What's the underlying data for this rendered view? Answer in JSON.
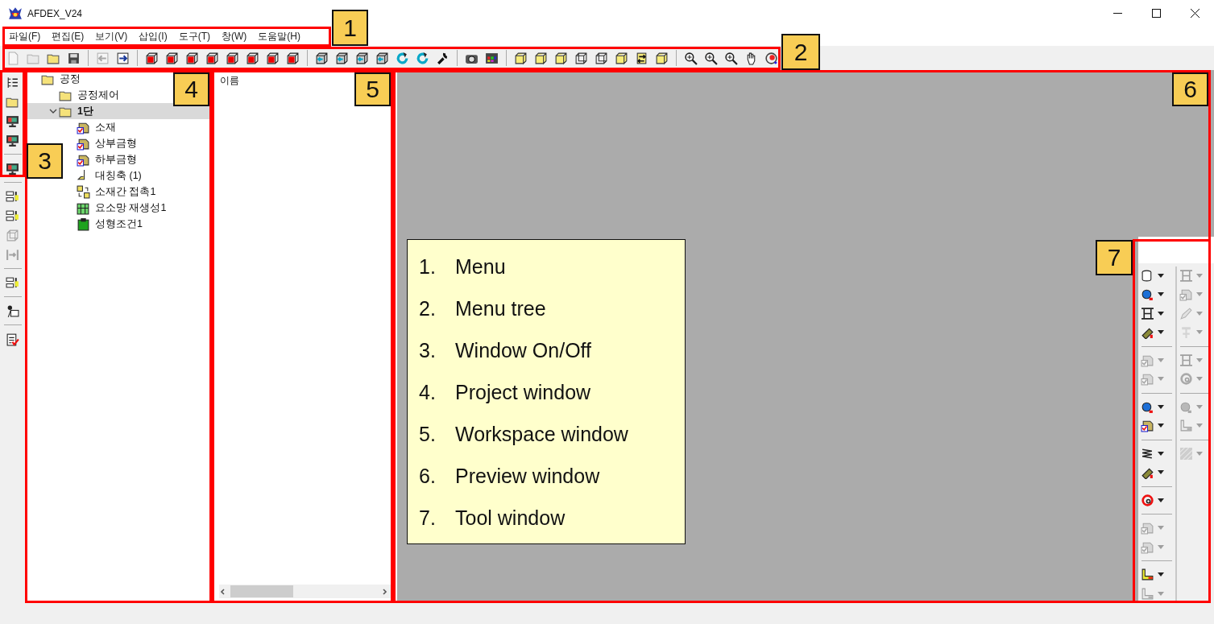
{
  "window": {
    "title": "AFDEX_V24"
  },
  "menu": [
    "파일(F)",
    "편집(E)",
    "보기(V)",
    "삽입(I)",
    "도구(T)",
    "창(W)",
    "도움말(H)"
  ],
  "toolbar": {
    "groups": [
      [
        {
          "kind": "page",
          "disabled": true
        },
        {
          "kind": "folder",
          "disabled": true
        },
        {
          "kind": "folder",
          "disabled": false
        },
        {
          "kind": "save",
          "disabled": false
        }
      ],
      [
        {
          "kind": "import",
          "disabled": true
        },
        {
          "kind": "export",
          "disabled": false
        }
      ],
      [
        {
          "kind": "cube",
          "disabled": false
        },
        {
          "kind": "cube",
          "disabled": false
        },
        {
          "kind": "cube",
          "disabled": false
        },
        {
          "kind": "cube",
          "disabled": false
        },
        {
          "kind": "cube",
          "disabled": false
        },
        {
          "kind": "cube",
          "disabled": false
        },
        {
          "kind": "cube",
          "disabled": false
        },
        {
          "kind": "cube",
          "disabled": false
        }
      ],
      [
        {
          "kind": "teal-cube",
          "disabled": false
        },
        {
          "kind": "teal-cube",
          "disabled": false
        },
        {
          "kind": "teal-cube",
          "disabled": false
        },
        {
          "kind": "teal-cube",
          "disabled": false
        },
        {
          "kind": "rotate",
          "disabled": false
        },
        {
          "kind": "rotate",
          "disabled": false
        },
        {
          "kind": "wrench",
          "disabled": false
        }
      ],
      [
        {
          "kind": "camera",
          "disabled": false
        },
        {
          "kind": "palette",
          "disabled": false
        }
      ],
      [
        {
          "kind": "box",
          "disabled": false
        },
        {
          "kind": "box",
          "disabled": false
        },
        {
          "kind": "box",
          "disabled": false
        },
        {
          "kind": "wire",
          "disabled": false
        },
        {
          "kind": "wire",
          "disabled": false
        },
        {
          "kind": "box",
          "disabled": false
        },
        {
          "kind": "swap",
          "disabled": false
        },
        {
          "kind": "box",
          "disabled": false
        }
      ],
      [
        {
          "kind": "zoom",
          "disabled": false
        },
        {
          "kind": "zoom",
          "disabled": false
        },
        {
          "kind": "zoom",
          "disabled": false
        },
        {
          "kind": "hand",
          "disabled": false
        },
        {
          "kind": "orbit",
          "disabled": false
        }
      ]
    ]
  },
  "sidebar": {
    "groups": [
      [
        {
          "kind": "tree",
          "disabled": false
        },
        {
          "kind": "folder",
          "disabled": false
        },
        {
          "kind": "monitor",
          "disabled": false
        },
        {
          "kind": "monitor",
          "disabled": false
        }
      ],
      [
        {
          "kind": "monitor",
          "disabled": false
        }
      ],
      [
        {
          "kind": "layout",
          "disabled": false
        },
        {
          "kind": "layout",
          "disabled": false
        },
        {
          "kind": "wire",
          "disabled": true
        },
        {
          "kind": "split",
          "disabled": true
        }
      ],
      [
        {
          "kind": "layout",
          "disabled": false
        }
      ],
      [
        {
          "kind": "probe",
          "disabled": false
        }
      ],
      [
        {
          "kind": "checklist",
          "disabled": false
        }
      ]
    ]
  },
  "project_tree": [
    {
      "label": "공정",
      "kind": "folder",
      "selected": false,
      "children": [
        {
          "label": "공정제어",
          "kind": "folder",
          "selected": false
        },
        {
          "label": "1단",
          "kind": "folder",
          "selected": true,
          "expanded": true,
          "children": [
            {
              "label": "소재",
              "kind": "part",
              "selected": false
            },
            {
              "label": "상부금형",
              "kind": "part",
              "selected": false
            },
            {
              "label": "하부금형",
              "kind": "part",
              "selected": false
            },
            {
              "label": "대칭축 (1)",
              "kind": "axis",
              "selected": false
            },
            {
              "label": "소재간 접촉1",
              "kind": "contact",
              "selected": false
            },
            {
              "label": "요소망 재생성1",
              "kind": "mesh",
              "selected": false
            },
            {
              "label": "성형조건1",
              "kind": "condition",
              "selected": false
            }
          ]
        }
      ]
    }
  ],
  "workspace": {
    "column_header": "이름"
  },
  "tool_window": {
    "columns": [
      {
        "groups": [
          [
            {
              "kind": "cylinder",
              "disabled": false
            },
            {
              "kind": "sphere",
              "disabled": false
            },
            {
              "kind": "frame",
              "disabled": false
            },
            {
              "kind": "plate",
              "disabled": false
            }
          ],
          [
            {
              "kind": "part",
              "disabled": true
            },
            {
              "kind": "part",
              "disabled": true
            }
          ],
          [
            {
              "kind": "sphere",
              "disabled": false
            },
            {
              "kind": "part",
              "disabled": false
            }
          ],
          [
            {
              "kind": "spring",
              "disabled": false
            },
            {
              "kind": "plate",
              "disabled": false
            }
          ],
          [
            {
              "kind": "ring",
              "disabled": false
            }
          ],
          [
            {
              "kind": "part",
              "disabled": true
            },
            {
              "kind": "part",
              "disabled": true
            }
          ],
          [
            {
              "kind": "corner",
              "disabled": false
            },
            {
              "kind": "corner",
              "disabled": true
            }
          ]
        ]
      },
      {
        "groups": [
          [
            {
              "kind": "frame",
              "disabled": true
            },
            {
              "kind": "part",
              "disabled": true
            },
            {
              "kind": "pencil",
              "disabled": true
            },
            {
              "kind": "pin",
              "disabled": true
            }
          ],
          [
            {
              "kind": "frame",
              "disabled": true
            },
            {
              "kind": "ring",
              "disabled": true
            }
          ],
          [
            {
              "kind": "sphere",
              "disabled": true
            },
            {
              "kind": "corner",
              "disabled": true
            }
          ],
          [
            {
              "kind": "hatch",
              "disabled": true
            }
          ]
        ]
      }
    ]
  },
  "annotations": {
    "callouts": [
      {
        "number": "1"
      },
      {
        "number": "2"
      },
      {
        "number": "3"
      },
      {
        "number": "4"
      },
      {
        "number": "5"
      },
      {
        "number": "6"
      },
      {
        "number": "7"
      }
    ],
    "legend": [
      {
        "number": "1.",
        "label": "Menu"
      },
      {
        "number": "2.",
        "label": "Menu tree"
      },
      {
        "number": "3.",
        "label": "Window On/Off"
      },
      {
        "number": "4.",
        "label": "Project window"
      },
      {
        "number": "5.",
        "label": "Workspace window"
      },
      {
        "number": "6.",
        "label": "Preview window"
      },
      {
        "number": "7.",
        "label": "Tool window"
      }
    ]
  }
}
